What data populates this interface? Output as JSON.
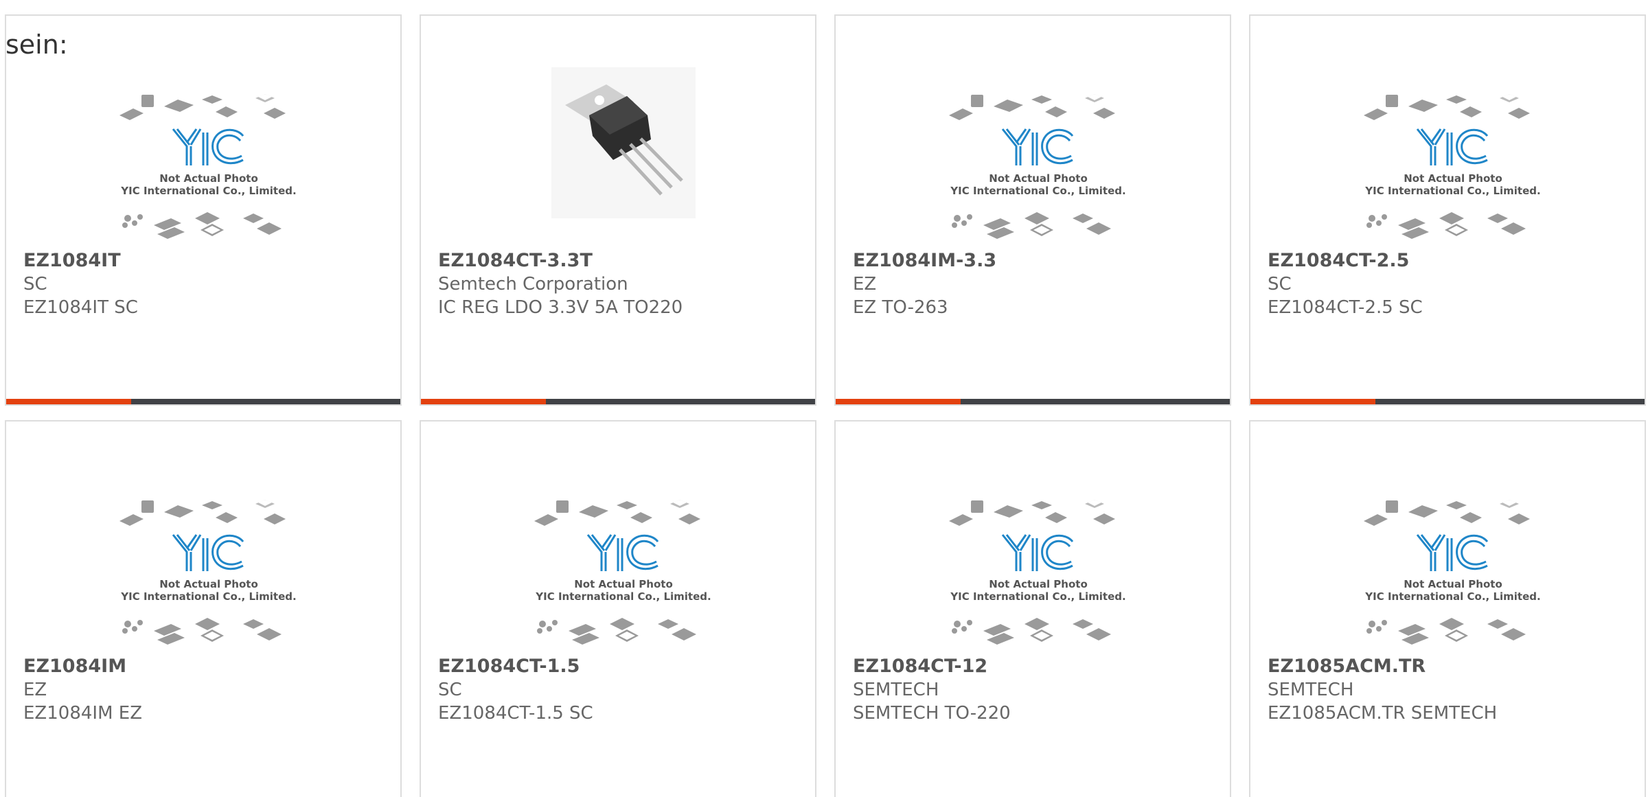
{
  "intro_text": "sein:",
  "placeholder": {
    "caption_line1": "Not Actual Photo",
    "caption_line2": "YIC International Co., Limited.",
    "logo_text": "YIC"
  },
  "colors": {
    "accent": "#e3410f",
    "bar_dark": "#404246",
    "logo_blue": "#1f86c8"
  },
  "products": [
    {
      "part": "EZ1084IT",
      "maker": "SC",
      "desc": "EZ1084IT SC",
      "image": "placeholder"
    },
    {
      "part": "EZ1084CT-3.3T",
      "maker": "Semtech Corporation",
      "desc": "IC REG LDO 3.3V 5A TO220",
      "image": "to220-photo"
    },
    {
      "part": "EZ1084IM-3.3",
      "maker": "EZ",
      "desc": "EZ TO-263",
      "image": "placeholder"
    },
    {
      "part": "EZ1084CT-2.5",
      "maker": "SC",
      "desc": "EZ1084CT-2.5 SC",
      "image": "placeholder"
    },
    {
      "part": "EZ1084IM",
      "maker": "EZ",
      "desc": "EZ1084IM EZ",
      "image": "placeholder"
    },
    {
      "part": "EZ1084CT-1.5",
      "maker": "SC",
      "desc": "EZ1084CT-1.5 SC",
      "image": "placeholder"
    },
    {
      "part": "EZ1084CT-12",
      "maker": "SEMTECH",
      "desc": "SEMTECH TO-220",
      "image": "placeholder"
    },
    {
      "part": "EZ1085ACM.TR",
      "maker": "SEMTECH",
      "desc": "EZ1085ACM.TR SEMTECH",
      "image": "placeholder"
    }
  ]
}
